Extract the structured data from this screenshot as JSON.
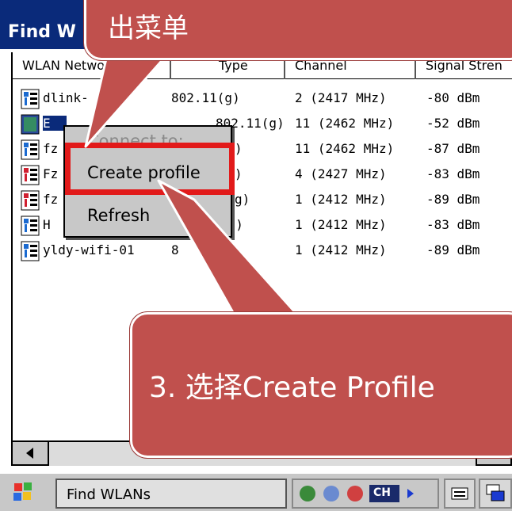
{
  "window": {
    "title": "Find W"
  },
  "table": {
    "headers": [
      "WLAN Network",
      "Type",
      "Channel",
      "Signal Stren"
    ],
    "rows": [
      {
        "name": "dlink-",
        "type": "802.11(g)",
        "channel": "2 (2417 MHz)",
        "signal": "-80 dBm"
      },
      {
        "name": "E",
        "type": "802.11(g)",
        "channel": "11 (2462 MHz)",
        "signal": "-52 dBm"
      },
      {
        "name": "fz",
        "type": ")",
        "channel": "11 (2462 MHz)",
        "signal": "-87 dBm"
      },
      {
        "name": "Fz",
        "type": ")",
        "channel": "4 (2427 MHz)",
        "signal": "-83 dBm"
      },
      {
        "name": "fz",
        "type": "g)",
        "channel": "1 (2412 MHz)",
        "signal": "-89 dBm"
      },
      {
        "name": "H",
        "type": "(g)",
        "channel": "1 (2412 MHz)",
        "signal": "-83 dBm"
      },
      {
        "name": "yldy-wifi-01",
        "type": "8",
        "channel": "1 (2412 MHz)",
        "signal": "-89 dBm"
      }
    ]
  },
  "context_menu": {
    "items": [
      {
        "label": "Connect to:",
        "enabled": false
      },
      {
        "label": "Create profile",
        "enabled": true
      },
      {
        "label": "Refresh",
        "enabled": true
      }
    ]
  },
  "taskbar": {
    "task_label": "Find WLANs",
    "tray_badge": "CH"
  },
  "callouts": {
    "top": "出菜单",
    "bottom": "3. 选择Create Profile"
  },
  "colors": {
    "callout": "#c0504d",
    "highlight": "#e21a1a",
    "titlebar": "#0a2a7a"
  },
  "icons": [
    "network-icon",
    "start-icon",
    "keyboard-icon",
    "scroll-left-icon",
    "scroll-right-icon"
  ]
}
